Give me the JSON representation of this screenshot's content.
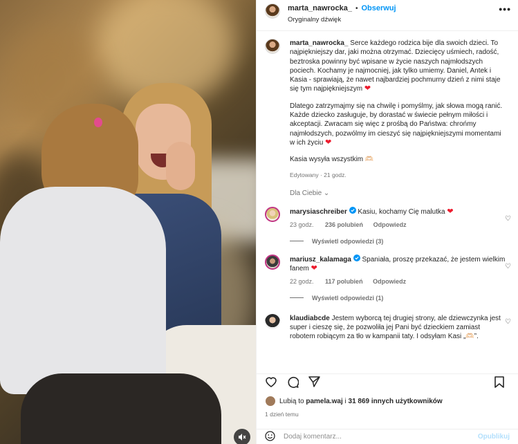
{
  "media": {
    "mute_icon": "speaker-muted-icon"
  },
  "header": {
    "username": "marta_nawrocka_",
    "separator": "•",
    "follow_label": "Obserwuj",
    "audio_label": "Oryginalny dźwięk",
    "more_icon": "•••"
  },
  "caption": {
    "username": "marta_nawrocka_",
    "para1": "Serce każdego rodzica bije dla swoich dzieci. To najpiękniejszy dar, jaki można otrzymać. Dziecięcy uśmiech, radość, beztroska powinny być wpisane w życie naszych najmłodszych pociech. Kochamy je najmocniej, jak tylko umiemy. Daniel, Antek i Kasia - sprawiają, że nawet najbardziej pochmurny dzień z nimi staje się tym najpiękniejszym",
    "para2": "Dlatego zatrzymajmy się na chwilę i pomyślmy, jak słowa mogą ranić. Każde dziecko zasługuje, by dorastać w świecie pełnym miłości i akceptacji. Zwracam się więc z prośbą do Państwa: chrońmy najmłodszych, pozwólmy im cieszyć się najpiękniejszymi momentami w ich życiu",
    "para3": "Kasia wysyła wszystkim 🫶🏻",
    "meta": "Edytowany · 21 godz.",
    "heart": "❤"
  },
  "filter_label": "Dla Ciebie ⌄",
  "comments": [
    {
      "username": "marysiaschreiber",
      "text": "Kasiu, kochamy Cię malutka",
      "time": "23 godz.",
      "likes": "236 polubień",
      "reply": "Odpowiedz",
      "view_replies": "Wyświetl odpowiedzi (3)",
      "avatar_color": "#d9c27a"
    },
    {
      "username": "mariusz_kalamaga",
      "text": "Spaniała, proszę przekazać, że jestem wielkim fanem",
      "time": "22 godz.",
      "likes": "117 polubień",
      "reply": "Odpowiedz",
      "view_replies": "Wyświetl odpowiedzi (1)",
      "avatar_color": "#3b3b3b"
    },
    {
      "username": "klaudiabcde",
      "text": "Jestem wyborcą tej drugiej strony, ale dziewczynka jest super i cieszę się, że pozwoliła jej Pani być dzieckiem zamiast robotem robiącym za tło w kampanii taty. I odsyłam Kasi „🫶🏻”.",
      "avatar_color": "#2a2a2a"
    }
  ],
  "likes": {
    "prefix": "Lubią to",
    "user": "pamela.waj",
    "middle": "i",
    "count": "31 869 innych użytkowników"
  },
  "date": "1 dzień temu",
  "add_comment": {
    "placeholder": "Dodaj komentarz...",
    "publish_label": "Opublikuj"
  },
  "colors": {
    "accent": "#0095f6",
    "heart": "#ed1c2e",
    "verified": "#0095f6"
  }
}
